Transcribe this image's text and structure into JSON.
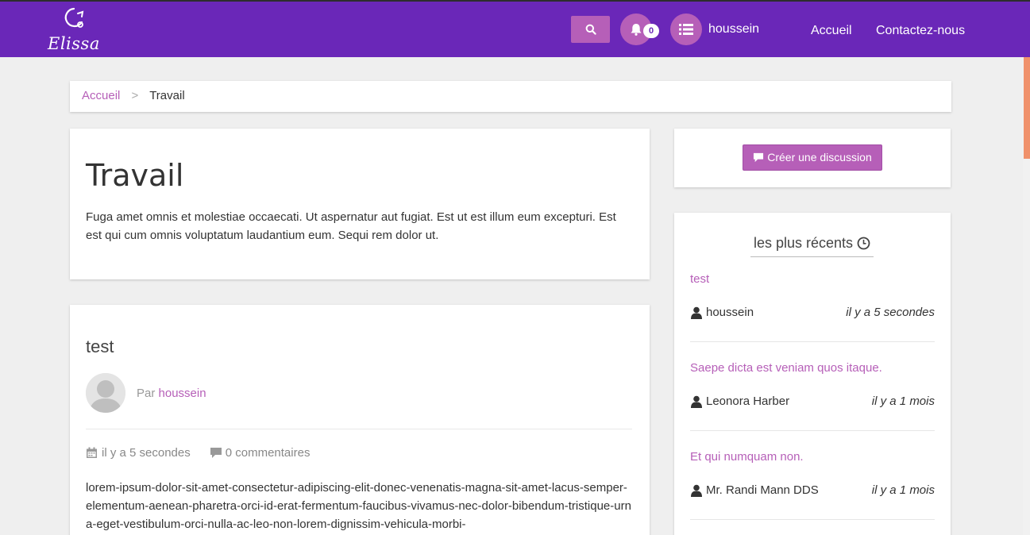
{
  "brand": {
    "name": "Elissa"
  },
  "header": {
    "notification_count": "0",
    "username": "houssein",
    "nav": [
      "Accueil",
      "Contactez-nous"
    ]
  },
  "breadcrumb": {
    "home": "Accueil",
    "separator": ">",
    "current": "Travail"
  },
  "category": {
    "title": "Travail",
    "description": "Fuga amet omnis et molestiae occaecati. Ut aspernatur aut fugiat. Est ut est illum eum excepturi. Est est qui cum omnis voluptatum laudantium eum. Sequi rem dolor ut."
  },
  "post": {
    "title": "test",
    "by_label": "Par",
    "author": "houssein",
    "time": "il y a 5 secondes",
    "comments": "0 commentaires",
    "body": "lorem-ipsum-dolor-sit-amet-consectetur-adipiscing-elit-donec-venenatis-magna-sit-amet-lacus-semper-elementum-aenean-pharetra-orci-id-erat-fermentum-faucibus-vivamus-nec-dolor-bibendum-tristique-urna-eget-vestibulum-orci-nulla-ac-leo-non-lorem-dignissim-vehicula-morbi-"
  },
  "sidebar": {
    "create_label": "Créer une discussion",
    "recent_title": "les plus récents",
    "recent": [
      {
        "title": "test",
        "author": "houssein",
        "time": "il y a 5 secondes"
      },
      {
        "title": "Saepe dicta est veniam quos itaque.",
        "author": "Leonora Harber",
        "time": "il y a 1 mois"
      },
      {
        "title": "Et qui numquam non.",
        "author": "Mr. Randi Mann DDS",
        "time": "il y a 1 mois"
      }
    ]
  },
  "colors": {
    "navbar": "#6a27b8",
    "accent": "#b65fb8",
    "background": "#efefef"
  },
  "icons": [
    "logo-mark-icon",
    "search-icon",
    "bell-icon",
    "list-icon",
    "comment-icon",
    "clock-icon",
    "calendar-icon",
    "user-icon",
    "avatar-placeholder-icon"
  ]
}
